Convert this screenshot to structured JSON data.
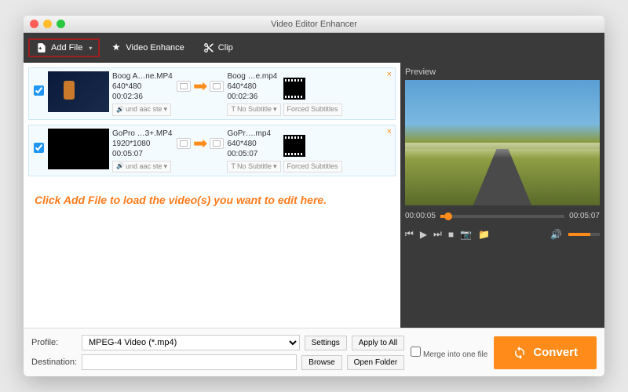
{
  "window": {
    "title": "Video Editor Enhancer"
  },
  "toolbar": {
    "add_file": "Add File",
    "video_enhance": "Video Enhance",
    "clip": "Clip"
  },
  "files": [
    {
      "checked": true,
      "src_name": "Boog A…ne.MP4",
      "src_res": "640*480",
      "src_dur": "00:02:36",
      "out_name": "Boog …e.mp4",
      "out_res": "640*480",
      "out_dur": "00:02:36",
      "audio_track": "und aac ste",
      "subtitle": "No Subtitle",
      "forced": "Forced Subtitles"
    },
    {
      "checked": true,
      "src_name": "GoPro …3+.MP4",
      "src_res": "1920*1080",
      "src_dur": "00:05:07",
      "out_name": "GoPr….mp4",
      "out_res": "640*480",
      "out_dur": "00:05:07",
      "audio_track": "und aac ste",
      "subtitle": "No Subtitle",
      "forced": "Forced Subtitles"
    }
  ],
  "hint": "Click Add File to load the video(s) you want to edit here.",
  "preview": {
    "label": "Preview",
    "current": "00:00:05",
    "total": "00:05:07"
  },
  "bottom": {
    "profile_label": "Profile:",
    "profile_value": "MPEG-4 Video (*.mp4)",
    "dest_label": "Destination:",
    "dest_value": "",
    "settings": "Settings",
    "apply_all": "Apply to All",
    "browse": "Browse",
    "open_folder": "Open Folder",
    "merge": "Merge into one file",
    "convert": "Convert"
  }
}
